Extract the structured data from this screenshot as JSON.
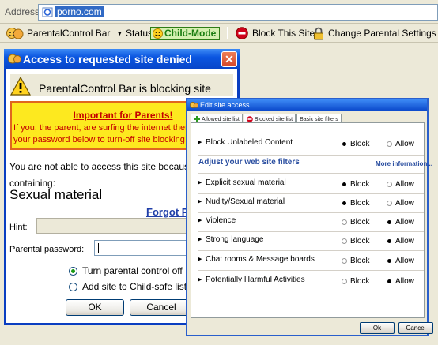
{
  "address_bar": {
    "label": "Address",
    "url": "porno.com",
    "favicon": "ie-page-icon"
  },
  "toolbar": {
    "app_name": "ParentalControl Bar",
    "status_label": "Status:",
    "mode_label": "Child-Mode",
    "block_label": "Block This Site",
    "change_label": "Change Parental Settings",
    "colors": {
      "mode_green": "#1a7d10",
      "block_red": "#d0021b"
    }
  },
  "denied_dialog": {
    "title": "Access to requested site denied",
    "blocking_text": "ParentalControl Bar is blocking site",
    "notice_title": "Important for Parents!",
    "notice_lines": [
      "If you, the parent, are surfing the internet ther",
      "your password below to turn-off site blocking"
    ],
    "reason_text": "You are not able to access this site because it i",
    "containing_label": "containing:",
    "category": "Sexual material",
    "forgot_link": "Forgot P",
    "hint_label": "Hint:",
    "hint_value": "",
    "password_label": "Parental  password:",
    "password_value": "",
    "options": [
      {
        "label": "Turn parental control off",
        "checked": true
      },
      {
        "label": "Add site to Child-safe list",
        "checked": false
      }
    ],
    "ok_label": "OK",
    "cancel_label": "Cancel",
    "colors": {
      "title_blue": "#0b55e0",
      "notice_yellow": "#fde91f",
      "notice_red": "#c40000",
      "link_blue": "#1f3ea8"
    }
  },
  "edit_dialog": {
    "title": "Edit site access",
    "tabs": [
      {
        "label": "Allowed site list",
        "icon": "plus-icon",
        "active": false
      },
      {
        "label": "Blocked site list",
        "icon": "no-entry-icon",
        "active": false
      },
      {
        "label": "Basic site filters",
        "icon": "",
        "active": true
      }
    ],
    "block_label": "Block",
    "allow_label": "Allow",
    "unlabeled": {
      "label": "Block Unlabeled Content",
      "value": "Block"
    },
    "adjust_heading": "Adjust your web site filters",
    "more_info": "More information...",
    "filters": [
      {
        "label": "Explicit sexual material",
        "value": "Block"
      },
      {
        "label": "Nudity/Sexual material",
        "value": "Block"
      },
      {
        "label": "Violence",
        "value": "Allow"
      },
      {
        "label": "Strong language",
        "value": "Allow"
      },
      {
        "label": "Chat rooms & Message boards",
        "value": "Allow"
      },
      {
        "label": "Potentially Harmful Activities",
        "value": "Allow"
      }
    ],
    "ok_label": "Ok",
    "cancel_label": "Cancel"
  }
}
